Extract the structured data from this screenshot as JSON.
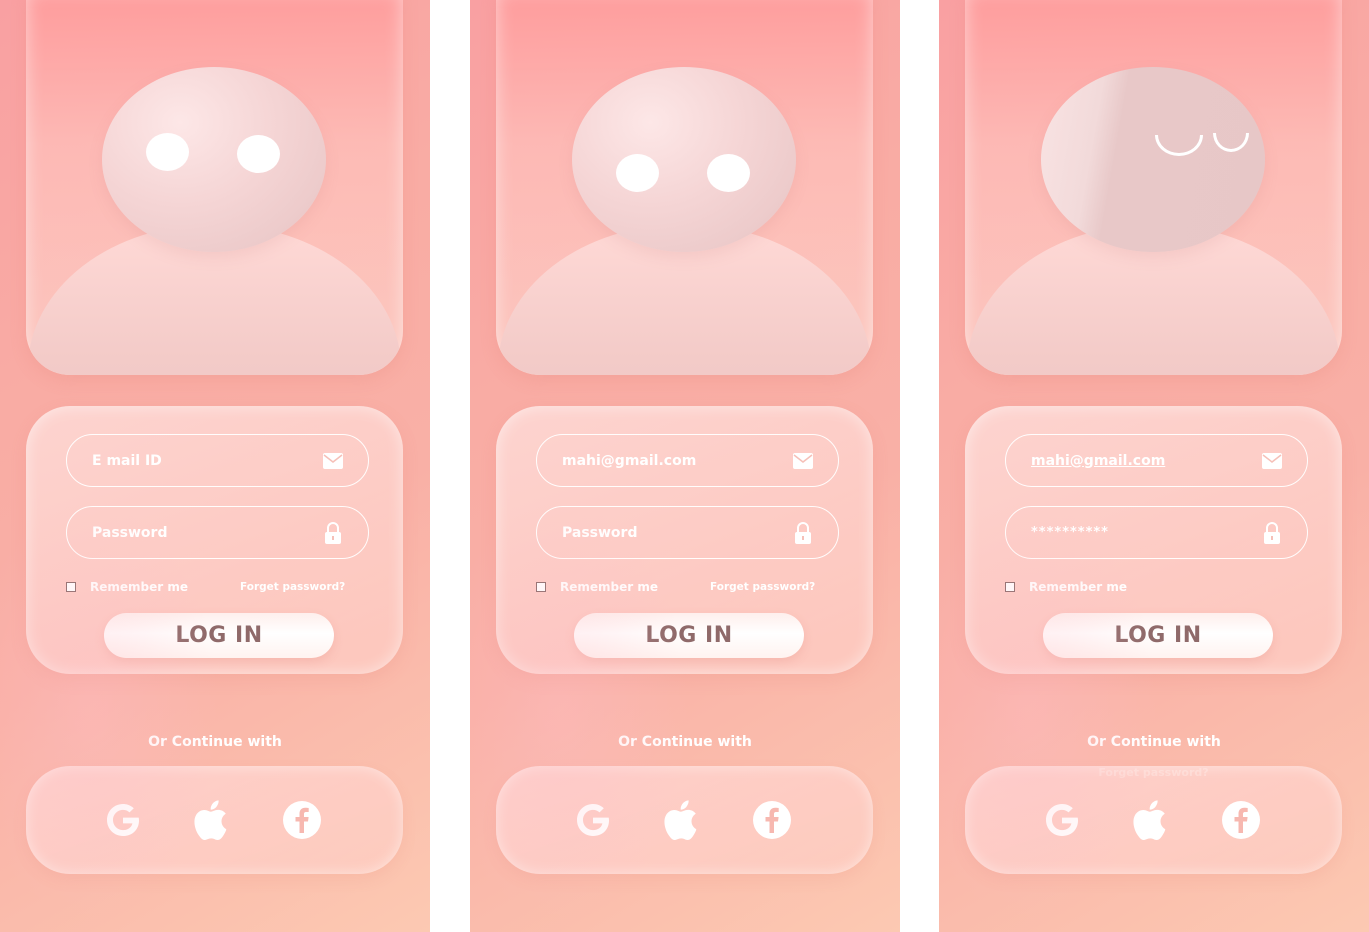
{
  "colors": {
    "panel_gradient_start": "#f9a0a2",
    "panel_gradient_end": "#fcc9b2",
    "login_text": "#8f6a6a",
    "white": "#ffffff"
  },
  "panels": [
    {
      "state": "idle",
      "email_value": "E mail ID",
      "password_value": "Password",
      "remember_label": "Remember me",
      "forget_label": "Forget password?",
      "login_label": "LOG IN",
      "continue_label": "Or Continue with"
    },
    {
      "state": "typing-email",
      "email_value": "mahi@gmail.com",
      "password_value": "Password",
      "remember_label": "Remember me",
      "forget_label": "Forget password?",
      "login_label": "LOG IN",
      "continue_label": "Or Continue with"
    },
    {
      "state": "typing-password",
      "email_value": "mahi@gmail.com",
      "password_value": "**********",
      "remember_label": "Remember me",
      "login_label": "LOG IN",
      "continue_label": "Or Continue with",
      "faint_label": "Forget password?"
    }
  ],
  "icons": {
    "email": "mail-icon",
    "password": "lock-icon",
    "google": "google-icon",
    "apple": "apple-icon",
    "facebook": "facebook-icon"
  }
}
